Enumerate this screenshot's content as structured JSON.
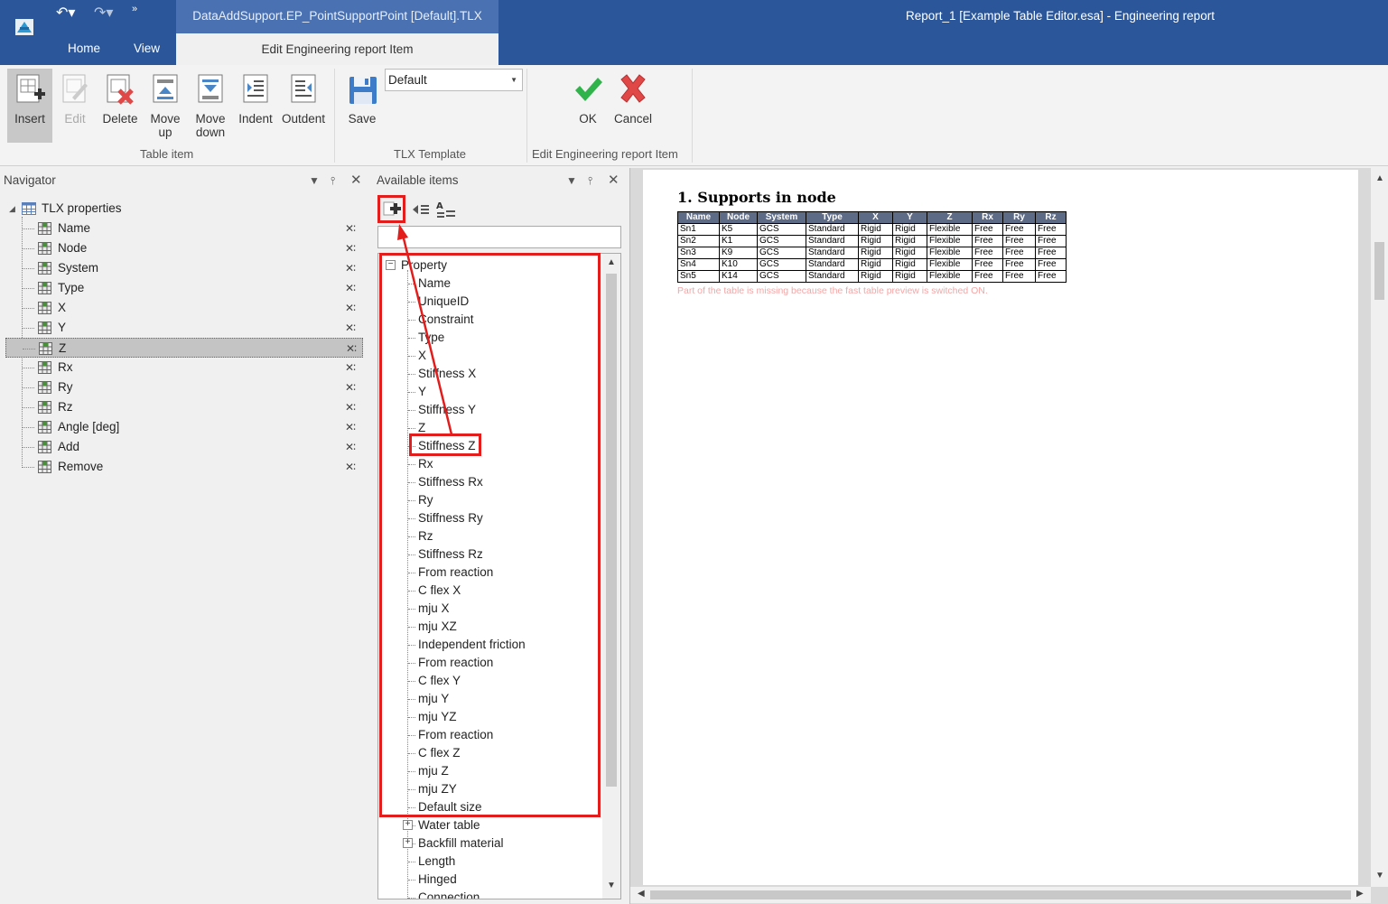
{
  "titlebar": {
    "doc_tab": "DataAddSupport.EP_PointSupportPoint [Default].TLX",
    "window_title": "Report_1 [Example Table Editor.esa] - Engineering report",
    "tabs": {
      "home": "Home",
      "view": "View",
      "edit_item": "Edit Engineering report Item"
    }
  },
  "ribbon": {
    "buttons": {
      "insert": "Insert",
      "edit": "Edit",
      "delete": "Delete",
      "move_up": "Move up",
      "move_down": "Move down",
      "indent": "Indent",
      "outdent": "Outdent",
      "save": "Save",
      "ok": "OK",
      "cancel": "Cancel"
    },
    "template_value": "Default",
    "groups": {
      "table_item": "Table item",
      "tlx_template": "TLX Template",
      "edit_item": "Edit Engineering report Item"
    }
  },
  "navigator": {
    "title": "Navigator",
    "root": "TLX properties",
    "items": [
      "Name",
      "Node",
      "System",
      "Type",
      "X",
      "Y",
      "Z",
      "Rx",
      "Ry",
      "Rz",
      "Angle [deg]",
      "Add",
      "Remove"
    ],
    "selected": "Z"
  },
  "available": {
    "title": "Available items",
    "property_group": "Property",
    "properties": [
      "Name",
      "UniqueID",
      "Constraint",
      "Type",
      "X",
      "Stiffness X",
      "Y",
      "Stiffness Y",
      "Z",
      "Stiffness Z",
      "Rx",
      "Stiffness Rx",
      "Ry",
      "Stiffness Ry",
      "Rz",
      "Stiffness Rz",
      "From reaction",
      "C flex X",
      "mju X",
      "mju XZ",
      "Independent friction",
      "From reaction",
      "C flex Y",
      "mju Y",
      "mju YZ",
      "From reaction",
      "C flex Z",
      "mju Z",
      "mju ZY",
      "Default size"
    ],
    "more": [
      {
        "label": "Water table",
        "expandable": true
      },
      {
        "label": "Backfill material",
        "expandable": true
      },
      {
        "label": "Length",
        "expandable": false
      },
      {
        "label": "Hinged",
        "expandable": false
      },
      {
        "label": "Connection",
        "expandable": false
      }
    ],
    "highlighted": "Stiffness Z"
  },
  "report": {
    "heading": "1. Supports  in node",
    "columns": [
      "Name",
      "Node",
      "System",
      "Type",
      "X",
      "Y",
      "Z",
      "Rx",
      "Ry",
      "Rz"
    ],
    "rows": [
      [
        "Sn1",
        "K5",
        "GCS",
        "Standard",
        "Rigid",
        "Rigid",
        "Flexible",
        "Free",
        "Free",
        "Free"
      ],
      [
        "Sn2",
        "K1",
        "GCS",
        "Standard",
        "Rigid",
        "Rigid",
        "Flexible",
        "Free",
        "Free",
        "Free"
      ],
      [
        "Sn3",
        "K9",
        "GCS",
        "Standard",
        "Rigid",
        "Rigid",
        "Flexible",
        "Free",
        "Free",
        "Free"
      ],
      [
        "Sn4",
        "K10",
        "GCS",
        "Standard",
        "Rigid",
        "Rigid",
        "Flexible",
        "Free",
        "Free",
        "Free"
      ],
      [
        "Sn5",
        "K14",
        "GCS",
        "Standard",
        "Rigid",
        "Rigid",
        "Flexible",
        "Free",
        "Free",
        "Free"
      ]
    ],
    "note": "Part of the table is missing because the fast table preview is switched ON."
  },
  "colors": {
    "titlebar": "#2b579a",
    "highlight": "#e31c1c",
    "table_header": "#5d6b87",
    "ok": "#2fb34a",
    "cancel": "#e04848"
  },
  "icons": {
    "app": "app-logo-icon",
    "undo": "undo-icon",
    "redo": "redo-icon",
    "add": "add-plus-icon",
    "insert_left": "insert-left-icon",
    "sort_az": "sort-az-icon",
    "grid": "grid-icon",
    "remove": "remove-x-icon",
    "pin": "pin-icon",
    "close": "close-icon",
    "dropdown": "chevron-down-icon"
  }
}
